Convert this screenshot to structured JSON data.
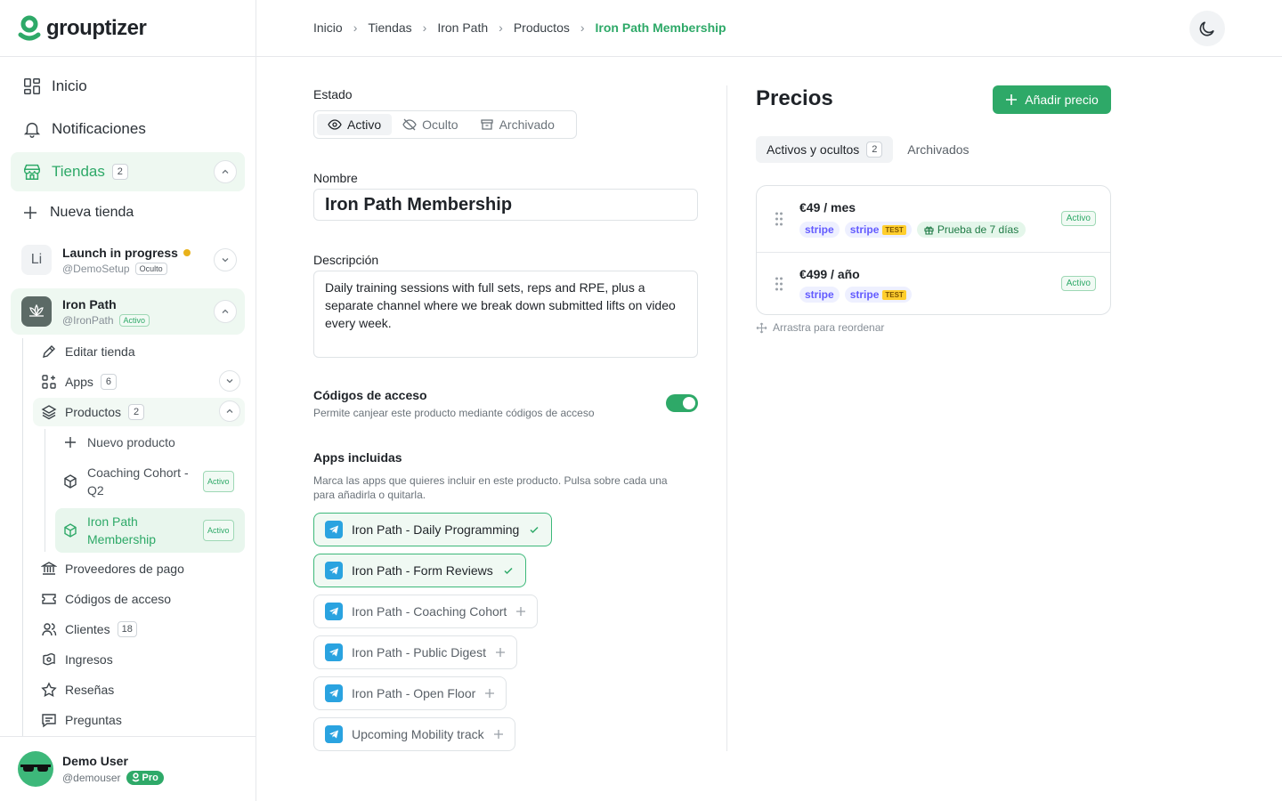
{
  "app": {
    "brand": "grouptizer"
  },
  "sidebar": {
    "nav": [
      {
        "label": "Inicio",
        "icon": "grid-icon"
      },
      {
        "label": "Notificaciones",
        "icon": "bell-icon"
      },
      {
        "label": "Tiendas",
        "icon": "store-icon",
        "badge": "2"
      }
    ],
    "new_store": "Nueva tienda",
    "stores": [
      {
        "initials": "Li",
        "name": "Launch in progress",
        "handle": "@DemoSetup",
        "tag": "Oculto"
      },
      {
        "name": "Iron Path",
        "handle": "@IronPath",
        "tag": "Activo"
      }
    ],
    "store_menu": [
      {
        "label": "Editar tienda",
        "icon": "pencil-icon"
      },
      {
        "label": "Apps",
        "icon": "apps-icon",
        "badge": "6"
      },
      {
        "label": "Productos",
        "icon": "layers-icon",
        "badge": "2"
      }
    ],
    "products_menu": {
      "new": "Nuevo producto",
      "items": [
        {
          "label": "Coaching Cohort - Q2",
          "tag": "Activo"
        },
        {
          "label": "Iron Path Membership",
          "tag": "Activo"
        }
      ]
    },
    "store_menu_bottom": [
      {
        "label": "Proveedores de pago",
        "icon": "bank-icon"
      },
      {
        "label": "Códigos de acceso",
        "icon": "ticket-icon"
      },
      {
        "label": "Clientes",
        "icon": "users-icon",
        "badge": "18"
      },
      {
        "label": "Ingresos",
        "icon": "money-icon"
      },
      {
        "label": "Reseñas",
        "icon": "star-icon"
      },
      {
        "label": "Preguntas",
        "icon": "message-icon"
      }
    ],
    "user": {
      "name": "Demo User",
      "handle": "@demouser",
      "plan": "Pro"
    }
  },
  "breadcrumb": [
    "Inicio",
    "Tiendas",
    "Iron Path",
    "Productos",
    "Iron Path Membership"
  ],
  "form": {
    "status_label": "Estado",
    "status_options": [
      "Activo",
      "Oculto",
      "Archivado"
    ],
    "status_selected": "Activo",
    "name_label": "Nombre",
    "name_value": "Iron Path Membership",
    "description_label": "Descripción",
    "description_value": "Daily training sessions with full sets, reps and RPE, plus a separate channel where we break down submitted lifts on video every week.",
    "access_codes_label": "Códigos de acceso",
    "access_codes_help": "Permite canjear este producto mediante códigos de acceso",
    "access_codes_enabled": true,
    "apps_label": "Apps incluidas",
    "apps_help": "Marca las apps que quieres incluir en este producto. Pulsa sobre cada una para añadirla o quitarla.",
    "apps": [
      {
        "name": "Iron Path - Daily Programming",
        "selected": true
      },
      {
        "name": "Iron Path - Form Reviews",
        "selected": true
      },
      {
        "name": "Iron Path - Coaching Cohort",
        "selected": false
      },
      {
        "name": "Iron Path - Public Digest",
        "selected": false
      },
      {
        "name": "Iron Path - Open Floor",
        "selected": false
      },
      {
        "name": "Upcoming Mobility track",
        "selected": false
      }
    ]
  },
  "prices": {
    "title": "Precios",
    "add_button": "Añadir precio",
    "tabs": [
      {
        "label": "Activos y ocultos",
        "badge": "2"
      },
      {
        "label": "Archivados"
      }
    ],
    "items": [
      {
        "amount": "€49 / mes",
        "providers": [
          "stripe",
          "stripe"
        ],
        "test_tag": "TEST",
        "trial": "Prueba de 7 días",
        "status": "Activo"
      },
      {
        "amount": "€499 / año",
        "providers": [
          "stripe",
          "stripe"
        ],
        "test_tag": "TEST",
        "status": "Activo"
      }
    ],
    "drag_hint": "Arrastra para reordenar"
  },
  "colors": {
    "accent": "#2ea968",
    "stripe": "#635bff",
    "telegram": "#2aa3e0"
  }
}
